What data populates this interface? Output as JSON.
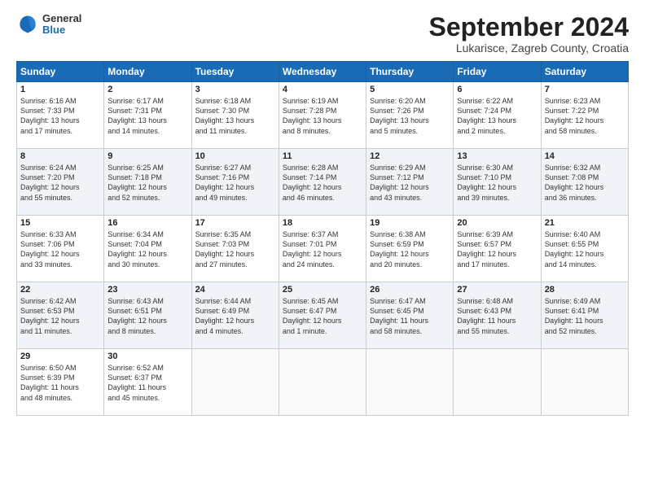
{
  "logo": {
    "general": "General",
    "blue": "Blue"
  },
  "header": {
    "month": "September 2024",
    "location": "Lukarisce, Zagreb County, Croatia"
  },
  "weekdays": [
    "Sunday",
    "Monday",
    "Tuesday",
    "Wednesday",
    "Thursday",
    "Friday",
    "Saturday"
  ],
  "weeks": [
    [
      {
        "day": "1",
        "text": "Sunrise: 6:16 AM\nSunset: 7:33 PM\nDaylight: 13 hours\nand 17 minutes."
      },
      {
        "day": "2",
        "text": "Sunrise: 6:17 AM\nSunset: 7:31 PM\nDaylight: 13 hours\nand 14 minutes."
      },
      {
        "day": "3",
        "text": "Sunrise: 6:18 AM\nSunset: 7:30 PM\nDaylight: 13 hours\nand 11 minutes."
      },
      {
        "day": "4",
        "text": "Sunrise: 6:19 AM\nSunset: 7:28 PM\nDaylight: 13 hours\nand 8 minutes."
      },
      {
        "day": "5",
        "text": "Sunrise: 6:20 AM\nSunset: 7:26 PM\nDaylight: 13 hours\nand 5 minutes."
      },
      {
        "day": "6",
        "text": "Sunrise: 6:22 AM\nSunset: 7:24 PM\nDaylight: 13 hours\nand 2 minutes."
      },
      {
        "day": "7",
        "text": "Sunrise: 6:23 AM\nSunset: 7:22 PM\nDaylight: 12 hours\nand 58 minutes."
      }
    ],
    [
      {
        "day": "8",
        "text": "Sunrise: 6:24 AM\nSunset: 7:20 PM\nDaylight: 12 hours\nand 55 minutes."
      },
      {
        "day": "9",
        "text": "Sunrise: 6:25 AM\nSunset: 7:18 PM\nDaylight: 12 hours\nand 52 minutes."
      },
      {
        "day": "10",
        "text": "Sunrise: 6:27 AM\nSunset: 7:16 PM\nDaylight: 12 hours\nand 49 minutes."
      },
      {
        "day": "11",
        "text": "Sunrise: 6:28 AM\nSunset: 7:14 PM\nDaylight: 12 hours\nand 46 minutes."
      },
      {
        "day": "12",
        "text": "Sunrise: 6:29 AM\nSunset: 7:12 PM\nDaylight: 12 hours\nand 43 minutes."
      },
      {
        "day": "13",
        "text": "Sunrise: 6:30 AM\nSunset: 7:10 PM\nDaylight: 12 hours\nand 39 minutes."
      },
      {
        "day": "14",
        "text": "Sunrise: 6:32 AM\nSunset: 7:08 PM\nDaylight: 12 hours\nand 36 minutes."
      }
    ],
    [
      {
        "day": "15",
        "text": "Sunrise: 6:33 AM\nSunset: 7:06 PM\nDaylight: 12 hours\nand 33 minutes."
      },
      {
        "day": "16",
        "text": "Sunrise: 6:34 AM\nSunset: 7:04 PM\nDaylight: 12 hours\nand 30 minutes."
      },
      {
        "day": "17",
        "text": "Sunrise: 6:35 AM\nSunset: 7:03 PM\nDaylight: 12 hours\nand 27 minutes."
      },
      {
        "day": "18",
        "text": "Sunrise: 6:37 AM\nSunset: 7:01 PM\nDaylight: 12 hours\nand 24 minutes."
      },
      {
        "day": "19",
        "text": "Sunrise: 6:38 AM\nSunset: 6:59 PM\nDaylight: 12 hours\nand 20 minutes."
      },
      {
        "day": "20",
        "text": "Sunrise: 6:39 AM\nSunset: 6:57 PM\nDaylight: 12 hours\nand 17 minutes."
      },
      {
        "day": "21",
        "text": "Sunrise: 6:40 AM\nSunset: 6:55 PM\nDaylight: 12 hours\nand 14 minutes."
      }
    ],
    [
      {
        "day": "22",
        "text": "Sunrise: 6:42 AM\nSunset: 6:53 PM\nDaylight: 12 hours\nand 11 minutes."
      },
      {
        "day": "23",
        "text": "Sunrise: 6:43 AM\nSunset: 6:51 PM\nDaylight: 12 hours\nand 8 minutes."
      },
      {
        "day": "24",
        "text": "Sunrise: 6:44 AM\nSunset: 6:49 PM\nDaylight: 12 hours\nand 4 minutes."
      },
      {
        "day": "25",
        "text": "Sunrise: 6:45 AM\nSunset: 6:47 PM\nDaylight: 12 hours\nand 1 minute."
      },
      {
        "day": "26",
        "text": "Sunrise: 6:47 AM\nSunset: 6:45 PM\nDaylight: 11 hours\nand 58 minutes."
      },
      {
        "day": "27",
        "text": "Sunrise: 6:48 AM\nSunset: 6:43 PM\nDaylight: 11 hours\nand 55 minutes."
      },
      {
        "day": "28",
        "text": "Sunrise: 6:49 AM\nSunset: 6:41 PM\nDaylight: 11 hours\nand 52 minutes."
      }
    ],
    [
      {
        "day": "29",
        "text": "Sunrise: 6:50 AM\nSunset: 6:39 PM\nDaylight: 11 hours\nand 48 minutes."
      },
      {
        "day": "30",
        "text": "Sunrise: 6:52 AM\nSunset: 6:37 PM\nDaylight: 11 hours\nand 45 minutes."
      },
      {
        "day": "",
        "text": ""
      },
      {
        "day": "",
        "text": ""
      },
      {
        "day": "",
        "text": ""
      },
      {
        "day": "",
        "text": ""
      },
      {
        "day": "",
        "text": ""
      }
    ]
  ]
}
